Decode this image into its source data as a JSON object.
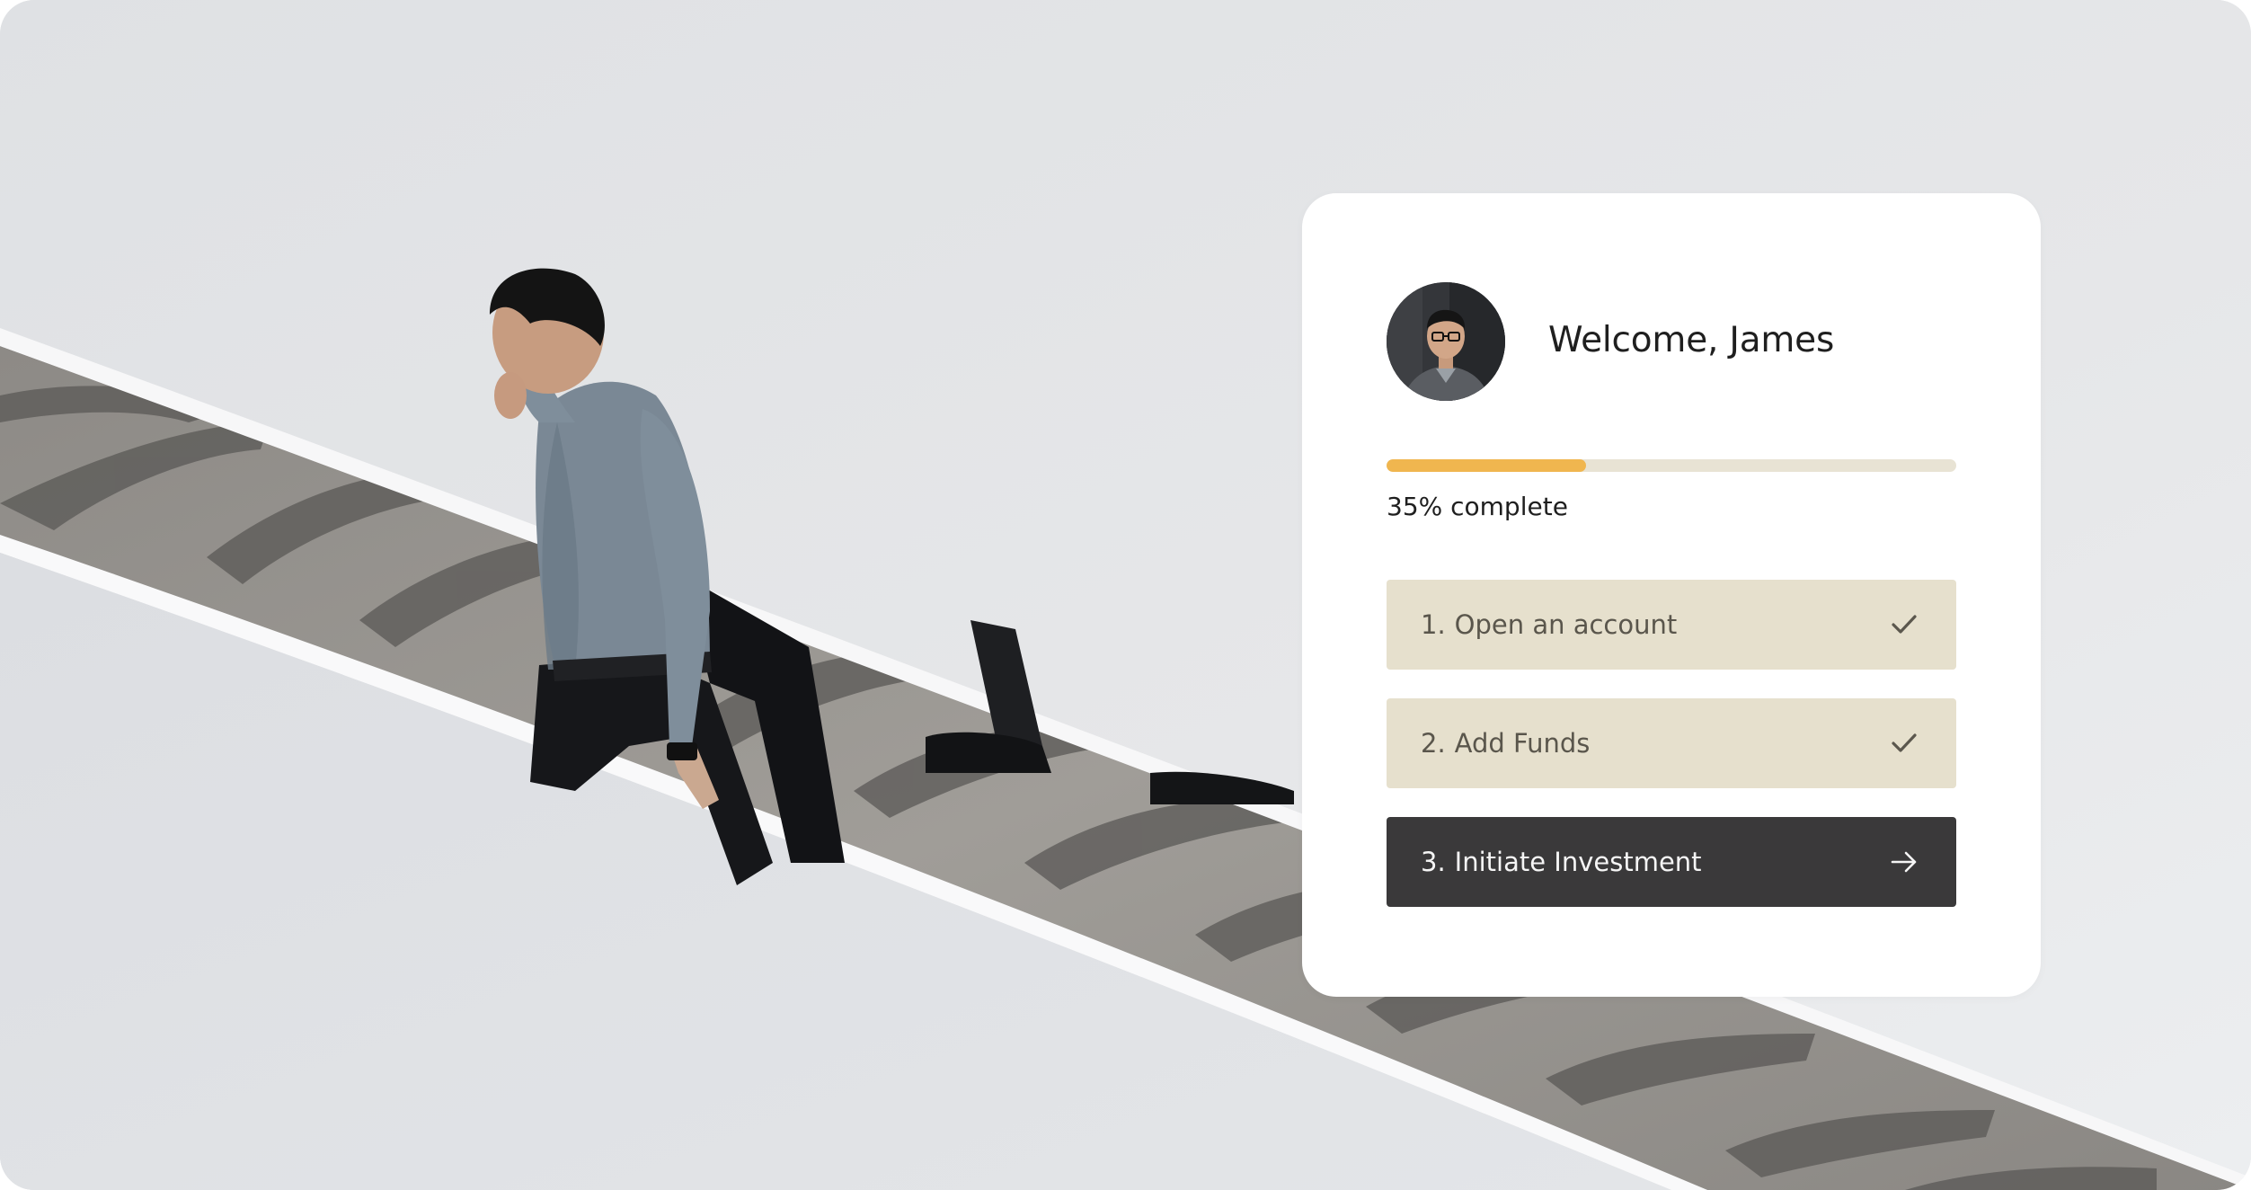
{
  "background": {
    "image": "man-walking-on-spiral-staircase"
  },
  "card": {
    "avatar": "user-avatar-james",
    "welcome_text": "Welcome, James",
    "progress": {
      "value_percent": 35,
      "label": "35% complete",
      "fill_color": "#f0b64f",
      "track_color": "#e8e3d4"
    },
    "steps": [
      {
        "number": "1.",
        "label": "Open an account",
        "status": "completed",
        "icon": "checkmark-icon"
      },
      {
        "number": "2.",
        "label": "Add Funds",
        "status": "completed",
        "icon": "checkmark-icon"
      },
      {
        "number": "3.",
        "label": "Initiate Investment",
        "status": "current",
        "icon": "arrow-right-icon"
      }
    ]
  },
  "colors": {
    "completed_step_bg": "#e6e0cd",
    "current_step_bg": "#3a393a",
    "accent": "#f0b64f"
  }
}
